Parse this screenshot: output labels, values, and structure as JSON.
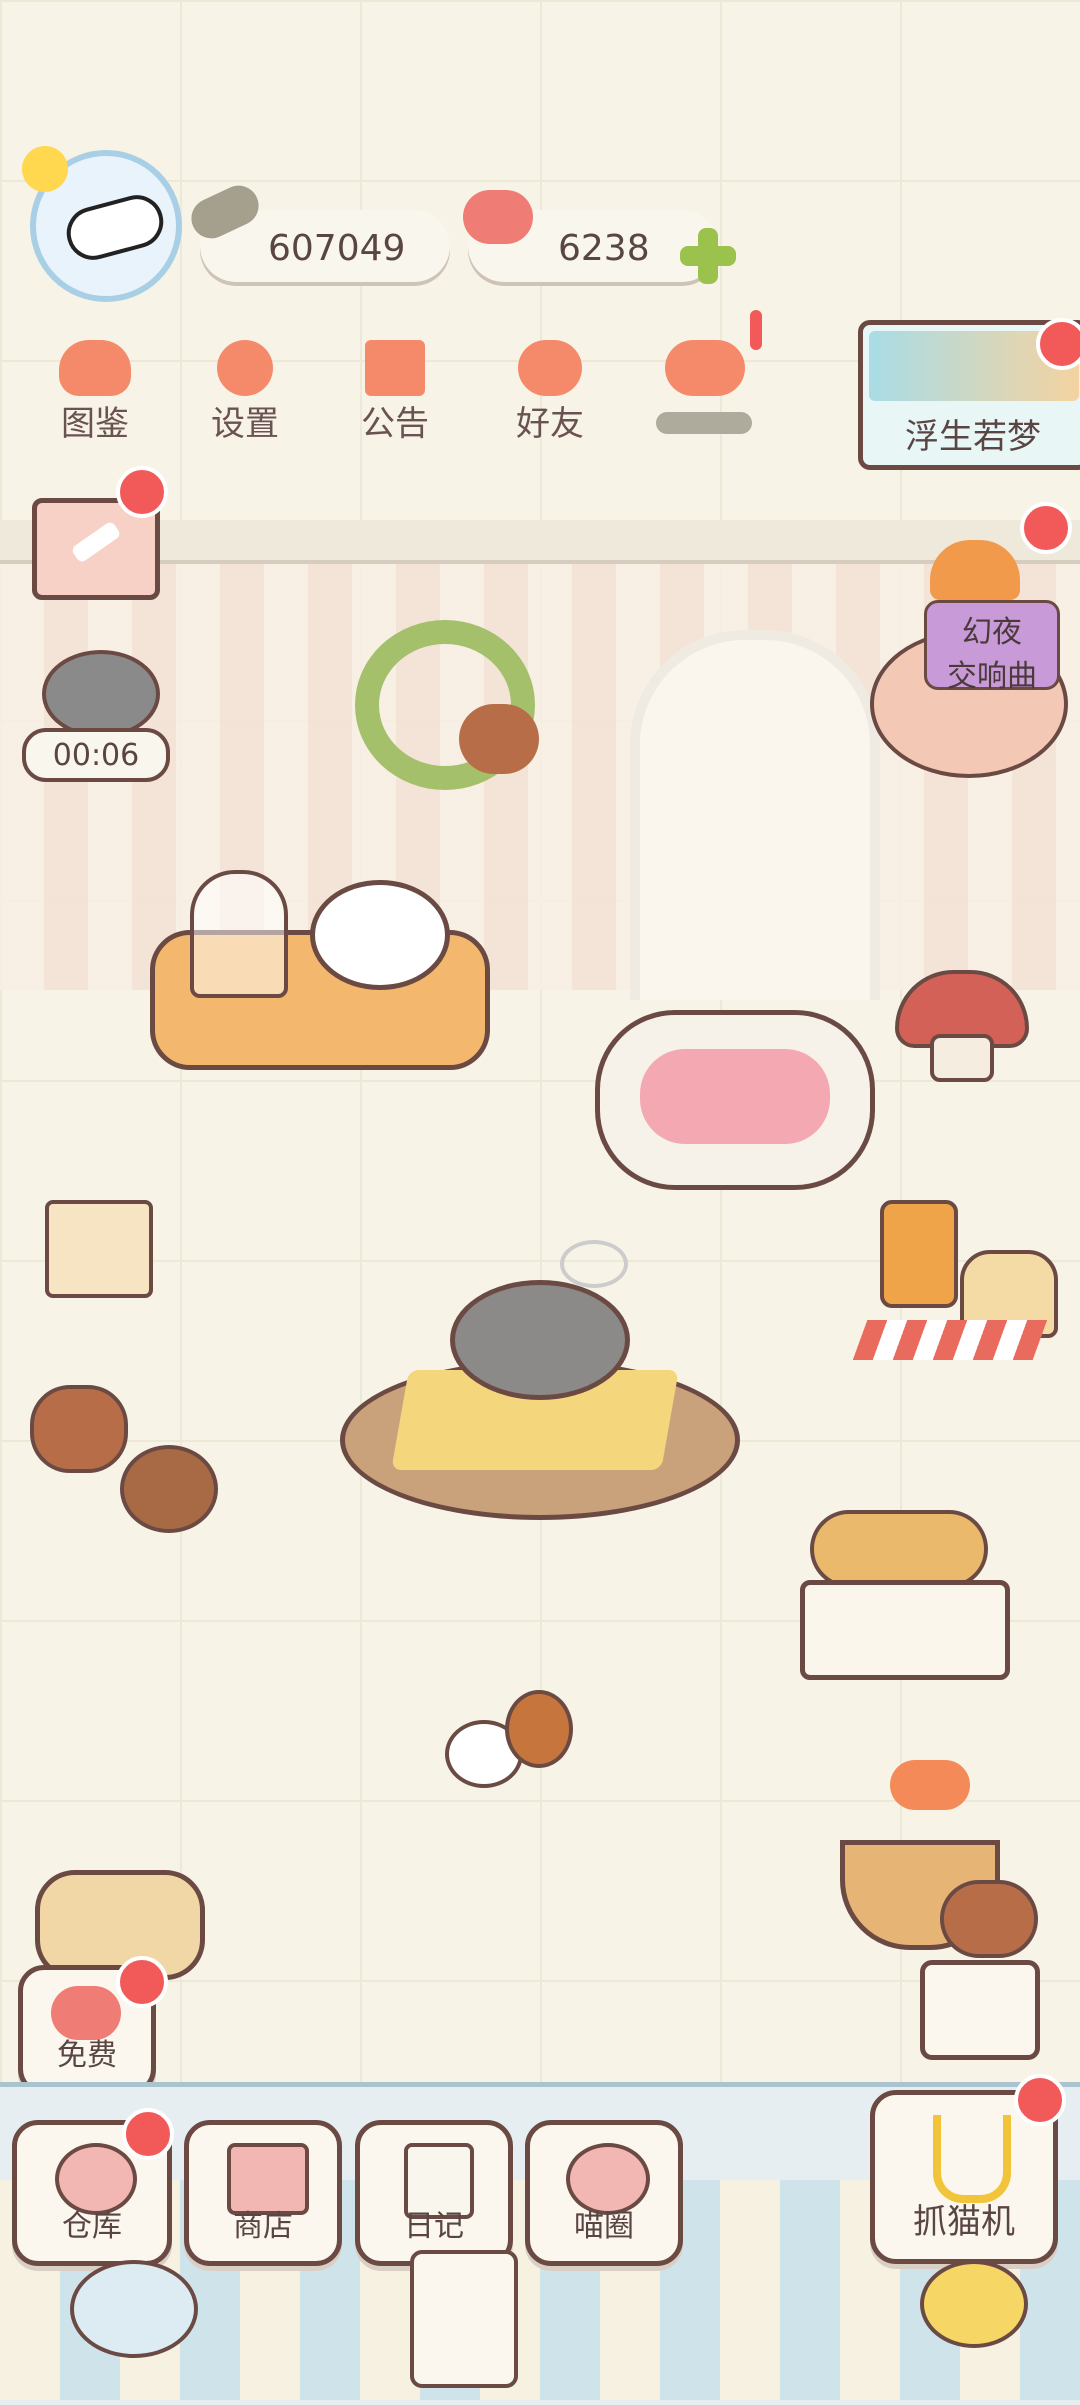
{
  "currency": {
    "fish": "607049",
    "hearts": "6238"
  },
  "menu": [
    {
      "label": "图鉴",
      "icon": "cat-face-icon"
    },
    {
      "label": "设置",
      "icon": "gear-icon"
    },
    {
      "label": "公告",
      "icon": "gift-icon"
    },
    {
      "label": "好友",
      "icon": "friends-icon"
    }
  ],
  "timer": "00:06",
  "events": {
    "event_a": "浮生若梦",
    "event_b_line1": "幻夜",
    "event_b_line2": "交响曲"
  },
  "left_free": "免费",
  "bottom_nav": [
    {
      "label": "仓库",
      "icon": "storage-icon"
    },
    {
      "label": "商店",
      "icon": "shop-icon"
    },
    {
      "label": "日记",
      "icon": "diary-icon"
    },
    {
      "label": "喵圈",
      "icon": "planet-cat-icon"
    }
  ],
  "claw_machine": "抓猫机",
  "colors": {
    "accent": "#f58a6a",
    "badge": "#f25a5a",
    "outline": "#6b4a44"
  }
}
